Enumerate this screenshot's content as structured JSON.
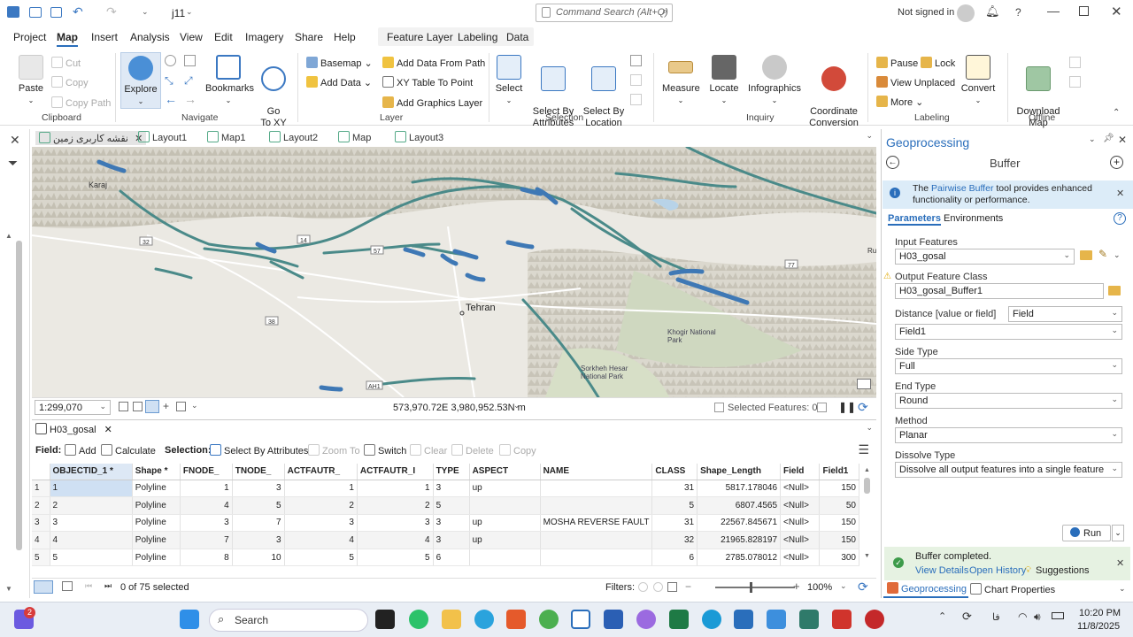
{
  "window": {
    "title": "j11",
    "command_search_placeholder": "Command Search (Alt+Q)",
    "signed_in": "Not signed in",
    "help": "?"
  },
  "menu": {
    "items": [
      "Project",
      "Map",
      "Insert",
      "Analysis",
      "View",
      "Edit",
      "Imagery",
      "Share",
      "Help"
    ],
    "context": [
      "Feature Layer",
      "Labeling",
      "Data"
    ]
  },
  "ribbon": {
    "clipboard": {
      "paste": "Paste",
      "cut": "Cut",
      "copy": "Copy",
      "copy_path": "Copy Path",
      "group": "Clipboard"
    },
    "navigate": {
      "explore": "Explore",
      "bookmarks": "Bookmarks",
      "goto": "Go\nTo XY",
      "group": "Navigate"
    },
    "layer": {
      "basemap": "Basemap",
      "add_data": "Add Data",
      "add_data_path": "Add Data From Path",
      "xy_table": "XY Table To Point",
      "add_graphics": "Add Graphics Layer",
      "group": "Layer"
    },
    "selection": {
      "select": "Select",
      "select_attr": "Select By\nAttributes",
      "select_loc": "Select By\nLocation",
      "group": "Selection"
    },
    "inquiry": {
      "measure": "Measure",
      "locate": "Locate",
      "infographics": "Infographics",
      "coord": "Coordinate\nConversion",
      "group": "Inquiry"
    },
    "labeling": {
      "pause": "Pause",
      "lock": "Lock",
      "view_unplaced": "View Unplaced",
      "more": "More",
      "convert": "Convert",
      "group": "Labeling"
    },
    "offline": {
      "download": "Download\nMap",
      "group": "Offline"
    }
  },
  "tabs": [
    "نقشه کاربری زمین",
    "Layout1",
    "Map1",
    "Layout2",
    "Map",
    "Layout3"
  ],
  "map": {
    "labels": {
      "karaj": "Karaj",
      "tehran": "Tehran",
      "khogir": "Khogir National\nPark",
      "sorkheh": "Sorkheh Hesar\nNational Park",
      "ru": "Ru",
      "rudkhaneh": "Rudkhaneh"
    },
    "shields": [
      "32",
      "14",
      "57",
      "38",
      "AH1",
      "77"
    ],
    "scale": "1:299,070",
    "coords": "573,970.72E 3,980,952.53N m",
    "selected_features": "Selected Features: 0"
  },
  "table": {
    "tab": "H03_gosal",
    "toolbar": {
      "field": "Field:",
      "add": "Add",
      "calculate": "Calculate",
      "selection": "Selection:",
      "select_by_attr": "Select By Attributes",
      "zoom_to": "Zoom To",
      "switch": "Switch",
      "clear": "Clear",
      "delete": "Delete",
      "copy": "Copy"
    },
    "columns": [
      "OBJECTID_1 *",
      "Shape *",
      "FNODE_",
      "TNODE_",
      "ACTFAUTR_",
      "ACTFAUTR_I",
      "TYPE",
      "ASPECT",
      "NAME",
      "CLASS",
      "Shape_Length",
      "Field",
      "Field1"
    ],
    "rows": [
      [
        "1",
        "1",
        "Polyline",
        "1",
        "3",
        "1",
        "1",
        "3",
        "up",
        "",
        "31",
        "5817.178046",
        "<Null>",
        "150"
      ],
      [
        "2",
        "2",
        "Polyline",
        "4",
        "5",
        "2",
        "2",
        "5",
        "",
        "",
        "5",
        "6807.4565",
        "<Null>",
        "50"
      ],
      [
        "3",
        "3",
        "Polyline",
        "3",
        "7",
        "3",
        "3",
        "3",
        "up",
        "MOSHA REVERSE FAULT",
        "31",
        "22567.845671",
        "<Null>",
        "150"
      ],
      [
        "4",
        "4",
        "Polyline",
        "7",
        "3",
        "4",
        "4",
        "3",
        "up",
        "",
        "32",
        "21965.828197",
        "<Null>",
        "150"
      ],
      [
        "5",
        "5",
        "Polyline",
        "8",
        "10",
        "5",
        "5",
        "6",
        "",
        "",
        "6",
        "2785.078012",
        "<Null>",
        "300"
      ]
    ],
    "status": "0 of 75 selected",
    "filters": "Filters:",
    "zoom": "100%"
  },
  "geoprocessing": {
    "title": "Geoprocessing",
    "tool": "Buffer",
    "info": "The Pairwise Buffer tool provides enhanced functionality or performance.",
    "info_prefix": "The ",
    "info_link": "Pairwise Buffer",
    "info_suffix": " tool provides enhanced functionality or performance.",
    "tab_params": "Parameters",
    "tab_env": "Environments",
    "input_label": "Input Features",
    "input_value": "H03_gosal",
    "output_label": "Output Feature Class",
    "output_value": "H03_gosal_Buffer1",
    "distance_label": "Distance [value or field]",
    "distance_mode": "Field",
    "distance_value": "Field1",
    "side_label": "Side Type",
    "side_value": "Full",
    "end_label": "End Type",
    "end_value": "Round",
    "method_label": "Method",
    "method_value": "Planar",
    "dissolve_label": "Dissolve Type",
    "dissolve_value": "Dissolve all output features into a single feature",
    "run": "Run",
    "completed": "Buffer completed.",
    "view_details": "View Details",
    "open_history": "Open History",
    "suggestions": "Suggestions",
    "bottom_tab1": "Geoprocessing",
    "bottom_tab2": "Chart Properties"
  },
  "taskbar": {
    "search": "Search",
    "time": "10:20 PM",
    "date": "11/8/2025",
    "lang": "فا",
    "badge": "2"
  }
}
